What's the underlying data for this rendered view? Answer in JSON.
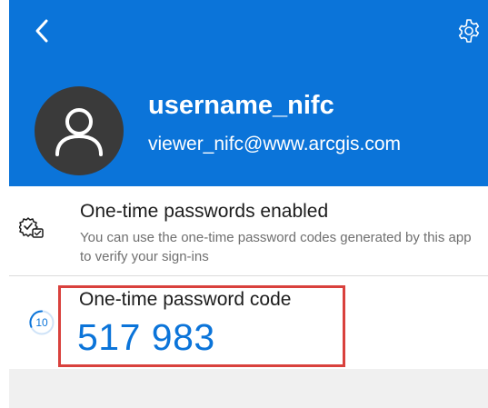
{
  "header": {
    "back_icon": "chevron-left-icon",
    "settings_icon": "gear-icon",
    "avatar_icon": "person-icon",
    "username": "username_nifc",
    "email": "viewer_nifc@www.arcgis.com",
    "background_color": "#0b74d9"
  },
  "otp_status": {
    "icon": "check-shield-icon",
    "title": "One-time passwords enabled",
    "description": "You can use the one-time password codes generated by this app to verify your sign-ins"
  },
  "otp_code": {
    "timer_value": "10",
    "label": "One-time password code",
    "code": "517 983",
    "code_color": "#0b74d9"
  },
  "highlight": {
    "color": "#d9413d"
  }
}
